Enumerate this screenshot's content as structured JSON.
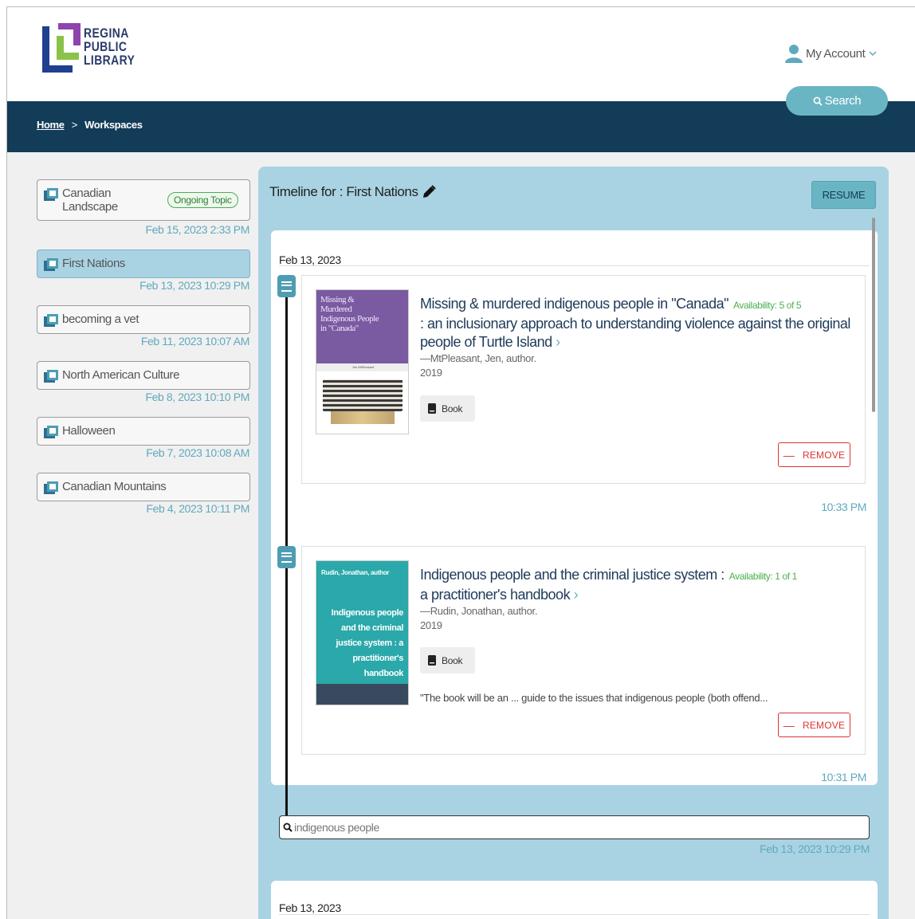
{
  "brand": {
    "line1": "REGINA",
    "line2": "PUBLIC",
    "line3": "LIBRARY",
    "colors": {
      "blue": "#1f3f8f",
      "green": "#8bc34a",
      "purple": "#8e44ad",
      "teal": "#6ab5c3",
      "navy": "#123c58"
    }
  },
  "header": {
    "account_label": "My Account",
    "search_label": "Search"
  },
  "breadcrumb": {
    "home": "Home",
    "separator": ">",
    "current": "Workspaces"
  },
  "workspaces": [
    {
      "label": "Canadian Landscape",
      "badge": "Ongoing Topic",
      "date": "Feb 15, 2023 2:33 PM",
      "icon": "library-books-icon"
    },
    {
      "label": "First Nations",
      "date": "Feb 13, 2023 10:29 PM",
      "active": true,
      "icon": "library-books-icon"
    },
    {
      "label": "becoming a vet",
      "date": "Feb 11, 2023 10:07 AM",
      "icon": "library-books-icon"
    },
    {
      "label": "North American Culture",
      "date": "Feb 8, 2023 10:10 PM",
      "icon": "library-books-icon"
    },
    {
      "label": "Halloween",
      "date": "Feb 7, 2023 10:08 AM",
      "icon": "library-books-icon"
    },
    {
      "label": "Canadian Mountains",
      "date": "Feb 4, 2023 10:11 PM",
      "icon": "library-books-icon"
    }
  ],
  "timeline": {
    "title": "Timeline for : First Nations",
    "resume_label": "RESUME",
    "groups": [
      {
        "day": "Feb 13, 2023",
        "entries": [
          {
            "title": "Missing & murdered indigenous people in \"Canada\"",
            "title_rest": ": an inclusionary approach to understanding violence against the original people of Turtle Island",
            "availability": "Availability: 5 of 5",
            "author": "—MtPleasant, Jen, author.",
            "year": "2019",
            "format": "Book",
            "time": "10:33 PM",
            "remove_label": "REMOVE",
            "cover": {
              "line1": "Missing &",
              "line2": "Murdered",
              "line3": "Indigenous People",
              "line4": "in \"Canada\"",
              "byline": "Jen MtPleasant"
            }
          },
          {
            "title": "Indigenous people and the criminal justice system :",
            "title_rest": "a practitioner's handbook",
            "availability": "Availability: 1 of 1",
            "author": "—Rudin, Jonathan, author.",
            "year": "2019",
            "format": "Book",
            "description": "\"The book will be an ... guide to the issues that indigenous people (both offend...",
            "time": "10:31 PM",
            "remove_label": "REMOVE",
            "cover": {
              "author": "Rudin, Jonathan, author",
              "line1": "Indigenous people",
              "line2": "and the criminal",
              "line3": "justice system : a",
              "line4": "practitioner's",
              "line5": "handbook"
            }
          }
        ],
        "search_query": "indigenous people",
        "search_date": "Feb 13, 2023 10:29 PM"
      },
      {
        "day": "Feb 13, 2023"
      }
    ]
  }
}
